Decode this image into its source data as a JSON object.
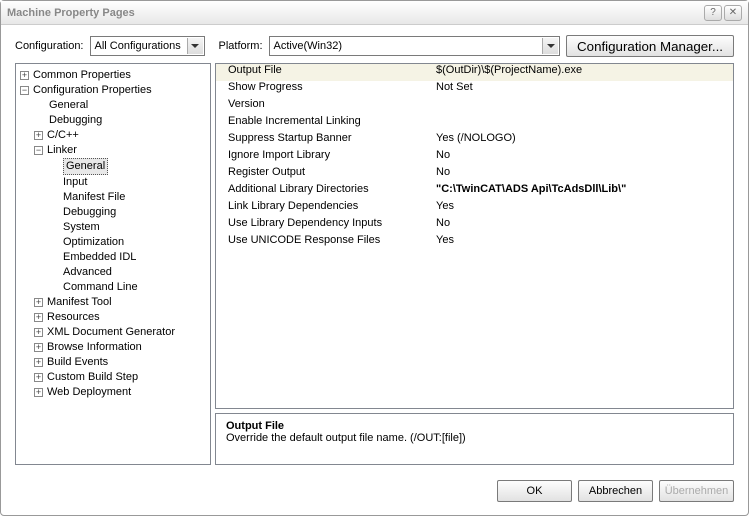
{
  "window": {
    "title": "Machine Property Pages"
  },
  "toolbar": {
    "config_label": "Configuration:",
    "config_value": "All Configurations",
    "platform_label": "Platform:",
    "platform_value": "Active(Win32)",
    "cfgmgr_label": "Configuration Manager..."
  },
  "tree": {
    "common": "Common Properties",
    "configprops": "Configuration Properties",
    "nodes": {
      "general": "General",
      "debugging": "Debugging",
      "cpp": "C/C++",
      "linker": "Linker",
      "linker_children": {
        "general": "General",
        "input": "Input",
        "manifest": "Manifest File",
        "debugging": "Debugging",
        "system": "System",
        "optimization": "Optimization",
        "embedded": "Embedded IDL",
        "advanced": "Advanced",
        "cmdline": "Command Line"
      },
      "manifest": "Manifest Tool",
      "resources": "Resources",
      "xmldoc": "XML Document Generator",
      "browse": "Browse Information",
      "build": "Build Events",
      "custom": "Custom Build Step",
      "webdeploy": "Web Deployment"
    }
  },
  "grid": [
    {
      "label": "Output File",
      "value": "$(OutDir)\\$(ProjectName).exe",
      "sel": true
    },
    {
      "label": "Show Progress",
      "value": "Not Set"
    },
    {
      "label": "Version",
      "value": ""
    },
    {
      "label": "Enable Incremental Linking",
      "value": ""
    },
    {
      "label": "Suppress Startup Banner",
      "value": "Yes (/NOLOGO)"
    },
    {
      "label": "Ignore Import Library",
      "value": "No"
    },
    {
      "label": "Register Output",
      "value": "No"
    },
    {
      "label": "Additional Library Directories",
      "value": "\"C:\\TwinCAT\\ADS Api\\TcAdsDll\\Lib\\\"",
      "bold": true
    },
    {
      "label": "Link Library Dependencies",
      "value": "Yes"
    },
    {
      "label": "Use Library Dependency Inputs",
      "value": "No"
    },
    {
      "label": "Use UNICODE Response Files",
      "value": "Yes"
    }
  ],
  "help": {
    "title": "Output File",
    "desc": "Override the default output file name.     (/OUT:[file])"
  },
  "footer": {
    "ok": "OK",
    "cancel": "Abbrechen",
    "apply": "Übernehmen"
  }
}
